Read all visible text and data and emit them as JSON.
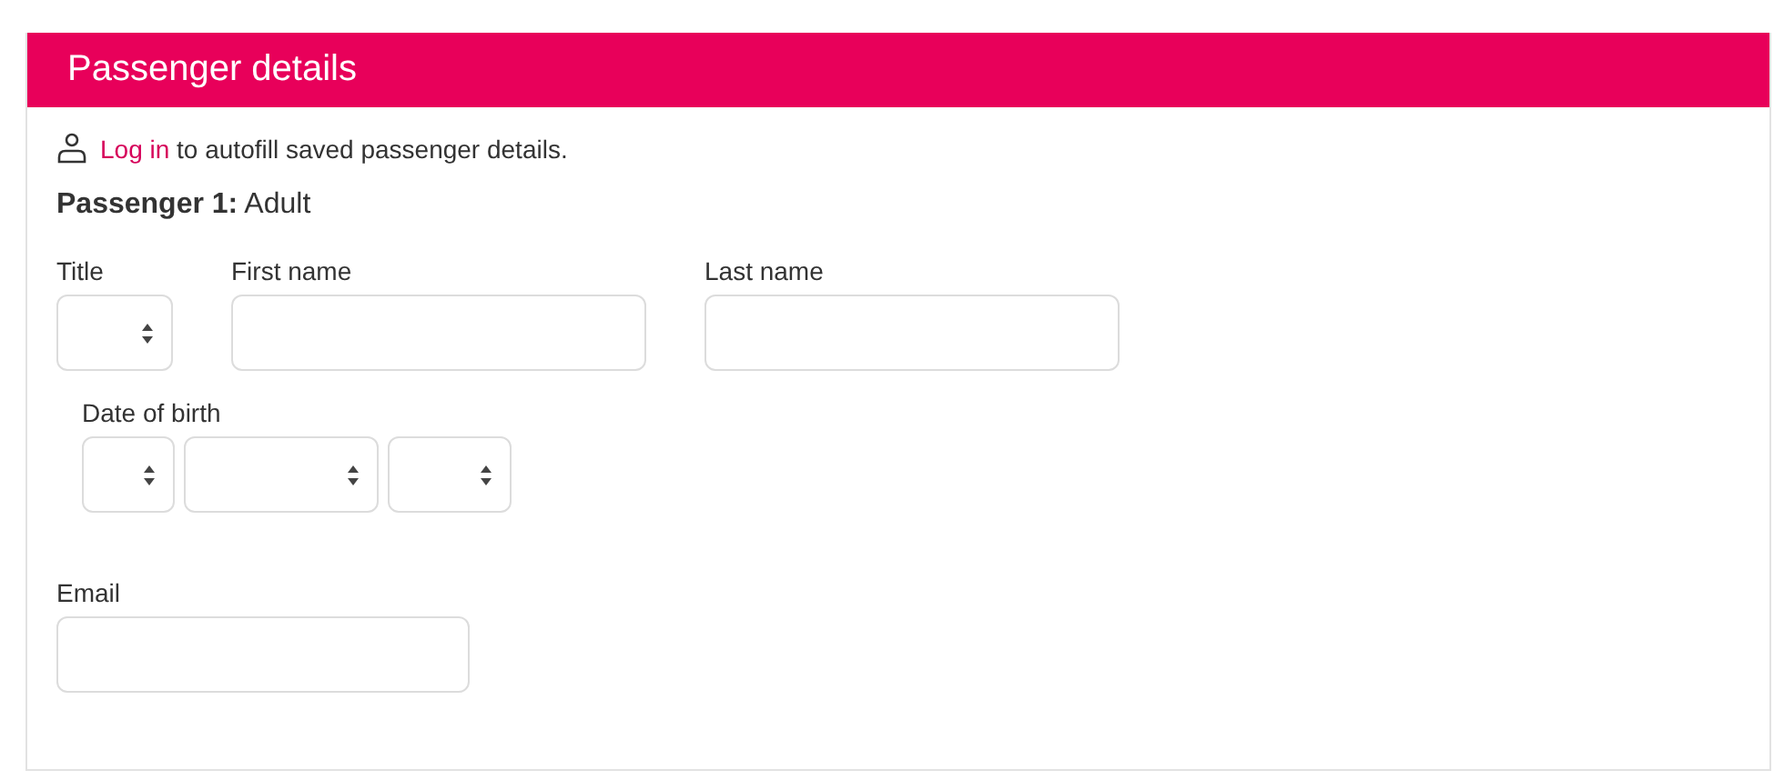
{
  "header": {
    "title": "Passenger details"
  },
  "login": {
    "link": "Log in",
    "text": "to autofill saved passenger details."
  },
  "passenger": {
    "heading": "**Passenger 1:** Adult"
  },
  "fields": {
    "title": {
      "label": "Title"
    },
    "first_name": {
      "label": "First name"
    },
    "last_name": {
      "label": "Last name"
    },
    "date_of_birth": {
      "label": "Date of birth"
    },
    "email": {
      "label": "Email"
    }
  }
}
